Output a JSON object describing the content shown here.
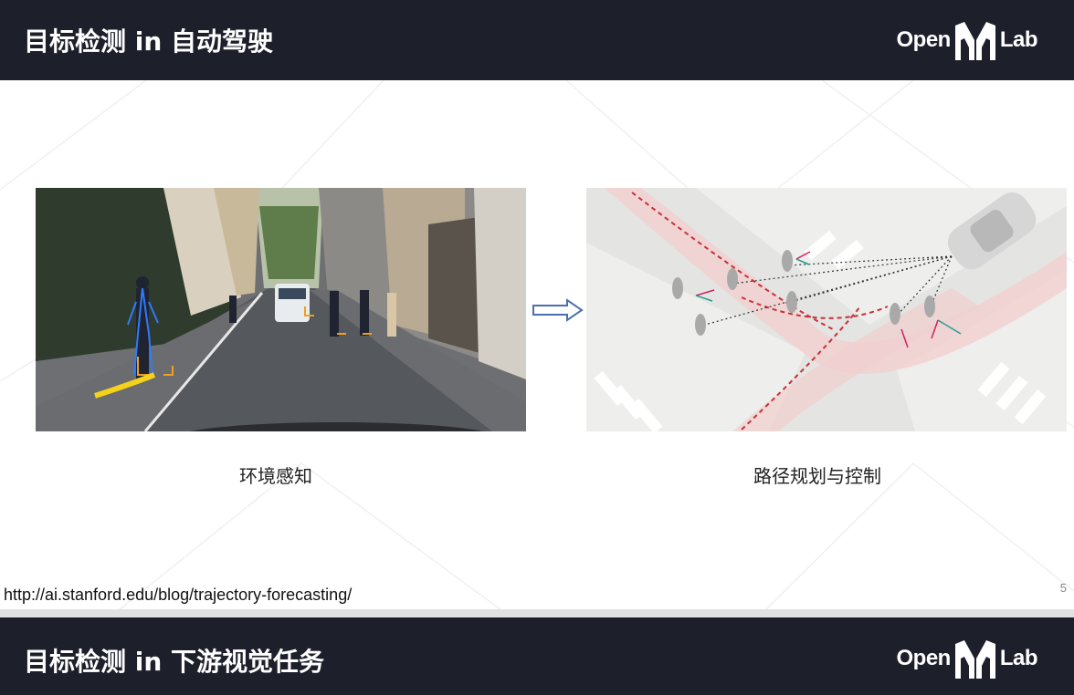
{
  "slide_top": {
    "title": "目标检测 in 自动驾驶",
    "logo_open": "Open",
    "logo_lab": "Lab"
  },
  "panels": {
    "left_caption": "环境感知",
    "right_caption": "路径规划与控制"
  },
  "source_link": "http://ai.stanford.edu/blog/trajectory-forecasting/",
  "page_number": "5",
  "slide_bottom": {
    "title": "目标检测 in 下游视觉任务",
    "logo_open": "Open",
    "logo_lab": "Lab"
  },
  "colors": {
    "header_bg": "#1d1f2b",
    "arrow": "#4a6fae",
    "path_red": "#c8313a"
  },
  "icons": [
    "mm-logo-icon",
    "right-arrow-icon"
  ]
}
